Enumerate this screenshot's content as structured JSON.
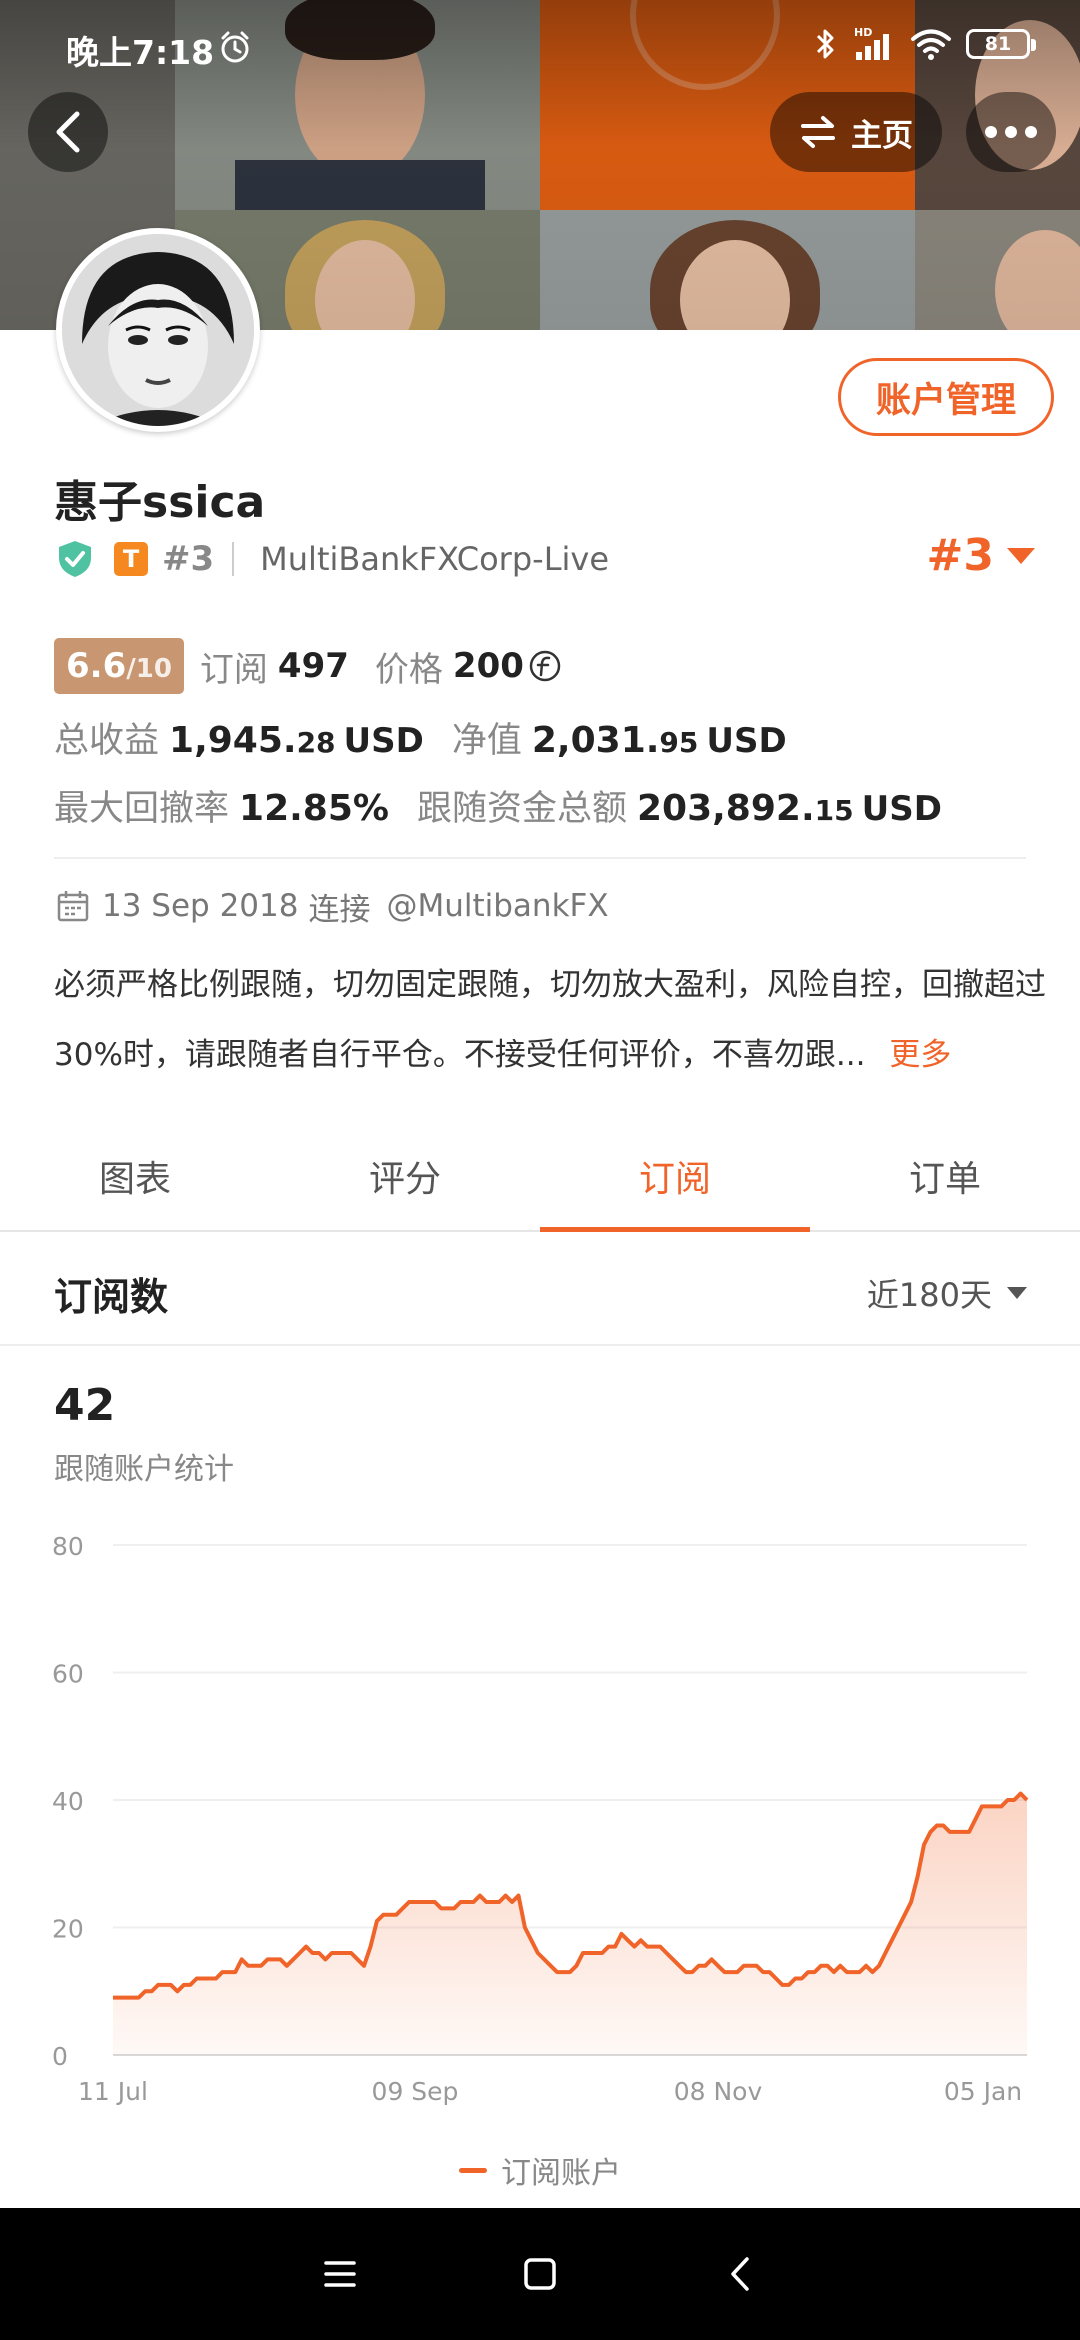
{
  "status_bar": {
    "time": "晚上7:18",
    "battery": "81"
  },
  "header": {
    "home_label": "主页"
  },
  "profile": {
    "account_manage_label": "账户管理",
    "username": "惠子ssica",
    "t_badge": "T",
    "rank_small": "#3",
    "server": "MultiBankFXCorp-Live",
    "rank_select": "#3"
  },
  "stats": {
    "rating_score": "6.6",
    "rating_max": "/10",
    "subscribe_label": "订阅",
    "subscribe_value": "497",
    "price_label": "价格",
    "price_value": "200",
    "total_profit_label": "总收益",
    "total_profit_int": "1,945.",
    "total_profit_cents": "28",
    "currency": "USD",
    "equity_label": "净值",
    "equity_int": "2,031.",
    "equity_cents": "95",
    "max_drawdown_label": "最大回撤率",
    "max_drawdown_value": "12.85%",
    "follow_funds_label": "跟随资金总额",
    "follow_funds_int": "203,892.",
    "follow_funds_cents": "15"
  },
  "connection": {
    "date": "13 Sep 2018",
    "connect_word": "连接",
    "handle": "@MultibankFX"
  },
  "description": {
    "text": "必须严格比例跟随，切勿固定跟随，切勿放大盈利，风险自控，回撤超过30%时，请跟随者自行平仓。不接受任何评价，不喜勿跟...",
    "more": "更多"
  },
  "tabs": [
    {
      "label": "图表"
    },
    {
      "label": "评分"
    },
    {
      "label": "订阅"
    },
    {
      "label": "订单"
    }
  ],
  "section": {
    "title": "订阅数",
    "range": "近180天",
    "count_value": "42",
    "count_label": "跟随账户统计"
  },
  "chart_data": {
    "type": "area",
    "ylim": [
      0,
      80
    ],
    "yticks": [
      "0",
      "20",
      "40",
      "60",
      "80"
    ],
    "xticks": [
      "11 Jul",
      "09 Sep",
      "08 Nov",
      "05 Jan"
    ],
    "legend_position": "bottom",
    "grid": true,
    "series": [
      {
        "name": "订阅账户",
        "color": "#f0642a",
        "values": [
          9,
          9,
          9,
          9,
          9,
          10,
          10,
          11,
          11,
          11,
          10,
          11,
          11,
          12,
          12,
          12,
          12,
          13,
          13,
          13,
          15,
          14,
          14,
          14,
          15,
          15,
          15,
          14,
          15,
          16,
          17,
          16,
          16,
          15,
          16,
          16,
          16,
          16,
          15,
          14,
          17,
          21,
          22,
          22,
          22,
          23,
          24,
          24,
          24,
          24,
          24,
          23,
          23,
          23,
          24,
          24,
          24,
          25,
          24,
          24,
          24,
          25,
          24,
          25,
          20,
          18,
          16,
          15,
          14,
          13,
          13,
          13,
          14,
          16,
          16,
          16,
          16,
          17,
          17,
          19,
          18,
          17,
          18,
          17,
          17,
          17,
          16,
          15,
          14,
          13,
          13,
          14,
          14,
          15,
          14,
          13,
          13,
          13,
          14,
          14,
          14,
          13,
          13,
          12,
          11,
          11,
          12,
          12,
          13,
          13,
          14,
          14,
          13,
          14,
          13,
          13,
          13,
          14,
          13,
          14,
          16,
          18,
          20,
          22,
          24,
          28,
          33,
          35,
          36,
          36,
          35,
          35,
          35,
          35,
          37,
          39,
          39,
          39,
          39,
          40,
          40,
          41,
          40
        ]
      }
    ]
  },
  "legend": {
    "label": "订阅账户"
  }
}
